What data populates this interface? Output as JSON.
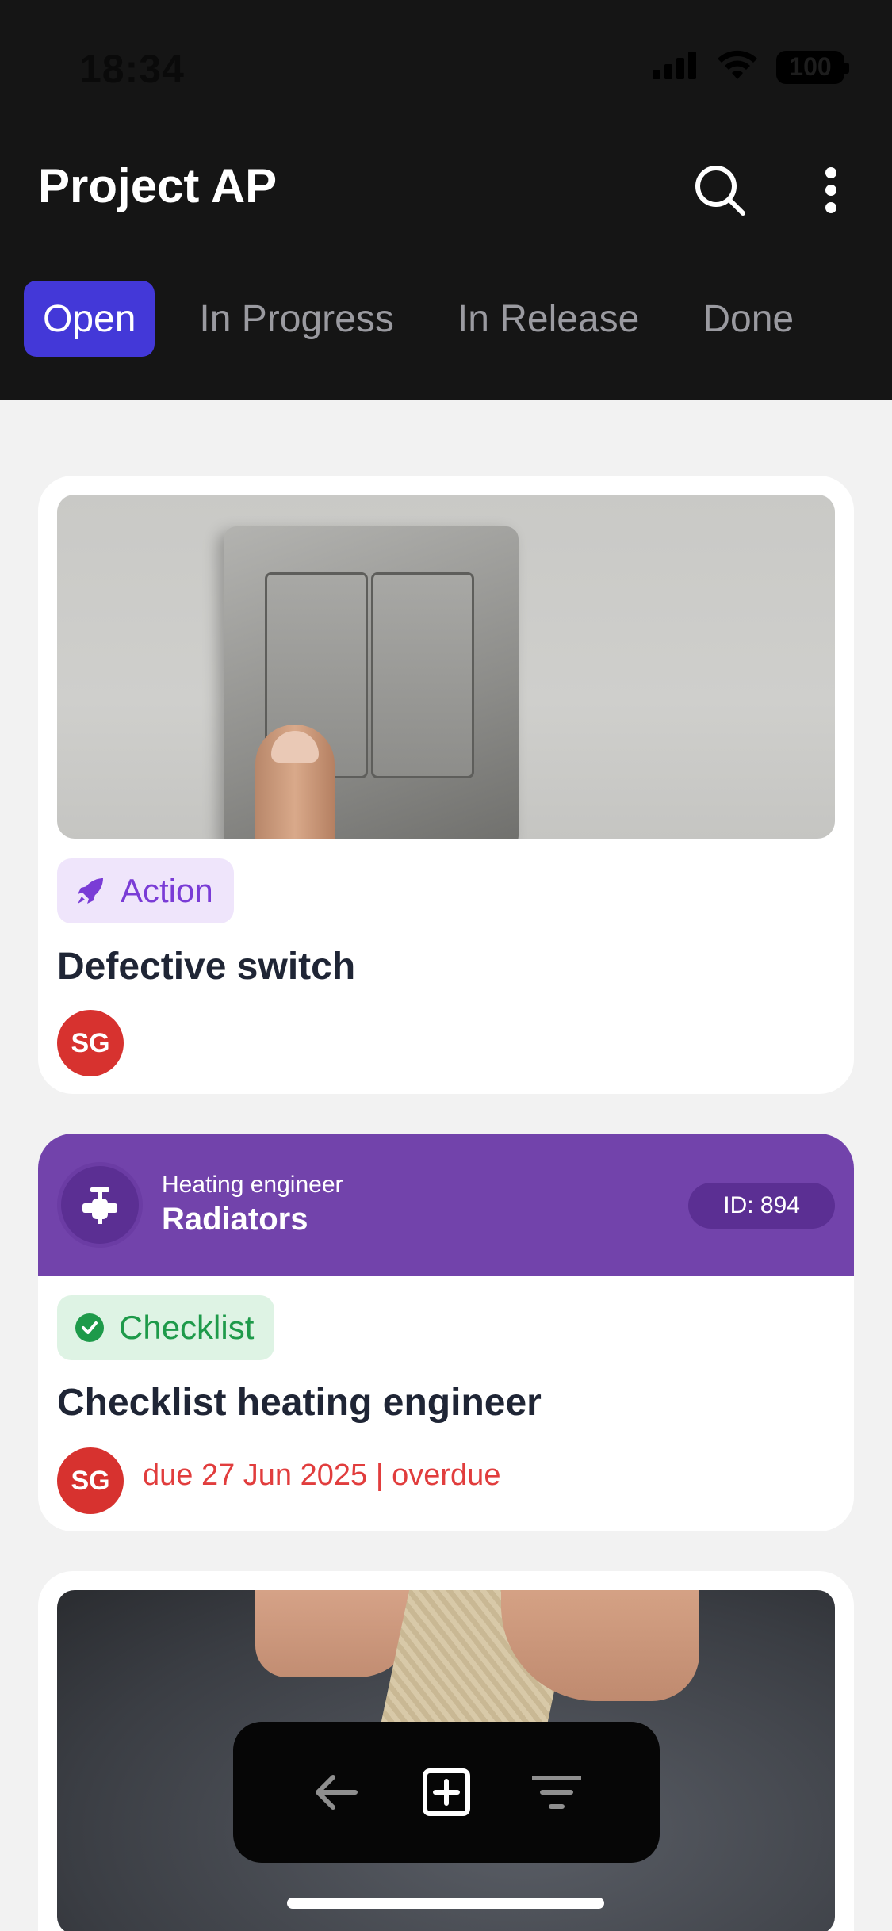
{
  "status": {
    "time": "18:34",
    "battery": "100"
  },
  "header": {
    "title": "Project AP"
  },
  "tabs": [
    {
      "label": "Open",
      "active": true
    },
    {
      "label": "In Progress",
      "active": false
    },
    {
      "label": "In Release",
      "active": false
    },
    {
      "label": "Done",
      "active": false
    }
  ],
  "cards": [
    {
      "badge": "Action",
      "title": "Defective switch",
      "assignee_initials": "SG"
    },
    {
      "trade_subtitle": "Heating engineer",
      "trade_name": "Radiators",
      "id_label": "ID: 894",
      "badge": "Checklist",
      "title": "Checklist heating engineer",
      "assignee_initials": "SG",
      "due": "due 27 Jun 2025 | overdue"
    }
  ],
  "colors": {
    "header_bg": "#151515",
    "active_tab": "#4338d8",
    "action_badge": "#7a3cd6",
    "checklist_badge": "#1e9a4a",
    "trade_header": "#7243ab",
    "avatar": "#d7322f",
    "overdue": "#e13d3d"
  },
  "icons": {
    "search": "search-icon",
    "more": "more-vertical-icon",
    "action": "rocket-icon",
    "checklist": "check-circle-icon",
    "trade": "radiator-valve-icon",
    "back": "arrow-left-icon",
    "add": "plus-square-icon",
    "filter": "filter-icon"
  }
}
